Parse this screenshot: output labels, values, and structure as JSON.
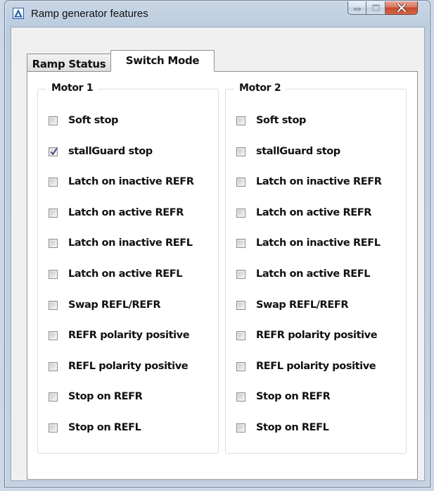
{
  "window": {
    "title": "Ramp generator features",
    "icon": "app-triangle-icon"
  },
  "tabs": [
    {
      "label": "Ramp Status",
      "selected": false
    },
    {
      "label": "Switch Mode",
      "selected": true
    }
  ],
  "groups": [
    {
      "title": "Motor 1",
      "options": [
        {
          "label": "Soft stop",
          "checked": false
        },
        {
          "label": "stallGuard stop",
          "checked": true
        },
        {
          "label": "Latch on inactive REFR",
          "checked": false
        },
        {
          "label": "Latch on active REFR",
          "checked": false
        },
        {
          "label": "Latch on inactive REFL",
          "checked": false
        },
        {
          "label": "Latch on active REFL",
          "checked": false
        },
        {
          "label": "Swap REFL/REFR",
          "checked": false
        },
        {
          "label": "REFR polarity positive",
          "checked": false
        },
        {
          "label": "REFL polarity positive",
          "checked": false
        },
        {
          "label": "Stop on REFR",
          "checked": false
        },
        {
          "label": "Stop on REFL",
          "checked": false
        }
      ]
    },
    {
      "title": "Motor 2",
      "options": [
        {
          "label": "Soft stop",
          "checked": false
        },
        {
          "label": "stallGuard stop",
          "checked": false
        },
        {
          "label": "Latch on inactive REFR",
          "checked": false
        },
        {
          "label": "Latch on active REFR",
          "checked": false
        },
        {
          "label": "Latch on inactive REFL",
          "checked": false
        },
        {
          "label": "Latch on active REFL",
          "checked": false
        },
        {
          "label": "Swap REFL/REFR",
          "checked": false
        },
        {
          "label": "REFR polarity positive",
          "checked": false
        },
        {
          "label": "REFL polarity positive",
          "checked": false
        },
        {
          "label": "Stop on REFR",
          "checked": false
        },
        {
          "label": "Stop on REFL",
          "checked": false
        }
      ]
    }
  ]
}
